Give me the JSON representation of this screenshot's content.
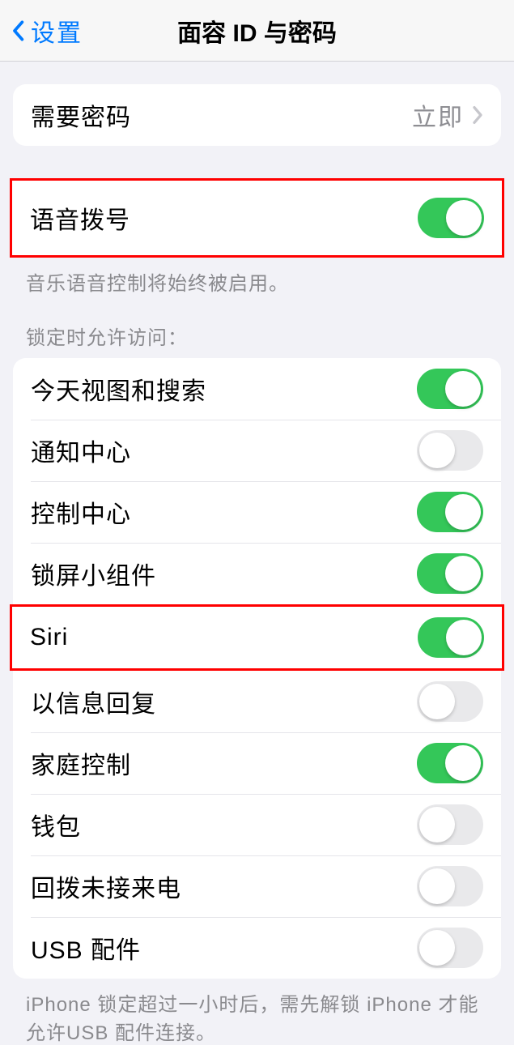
{
  "nav": {
    "back_label": "设置",
    "title": "面容 ID 与密码"
  },
  "require_passcode": {
    "label": "需要密码",
    "value": "立即"
  },
  "voice_dial": {
    "label": "语音拨号",
    "on": true,
    "footer": "音乐语音控制将始终被启用。"
  },
  "lock_access": {
    "header": "锁定时允许访问：",
    "items": [
      {
        "label": "今天视图和搜索",
        "on": true
      },
      {
        "label": "通知中心",
        "on": false
      },
      {
        "label": "控制中心",
        "on": true
      },
      {
        "label": "锁屏小组件",
        "on": true
      },
      {
        "label": "Siri",
        "on": true
      },
      {
        "label": "以信息回复",
        "on": false
      },
      {
        "label": "家庭控制",
        "on": true
      },
      {
        "label": "钱包",
        "on": false
      },
      {
        "label": "回拨未接来电",
        "on": false
      },
      {
        "label": "USB 配件",
        "on": false
      }
    ],
    "footer": "iPhone 锁定超过一小时后，需先解锁 iPhone 才能允许USB 配件连接。"
  }
}
